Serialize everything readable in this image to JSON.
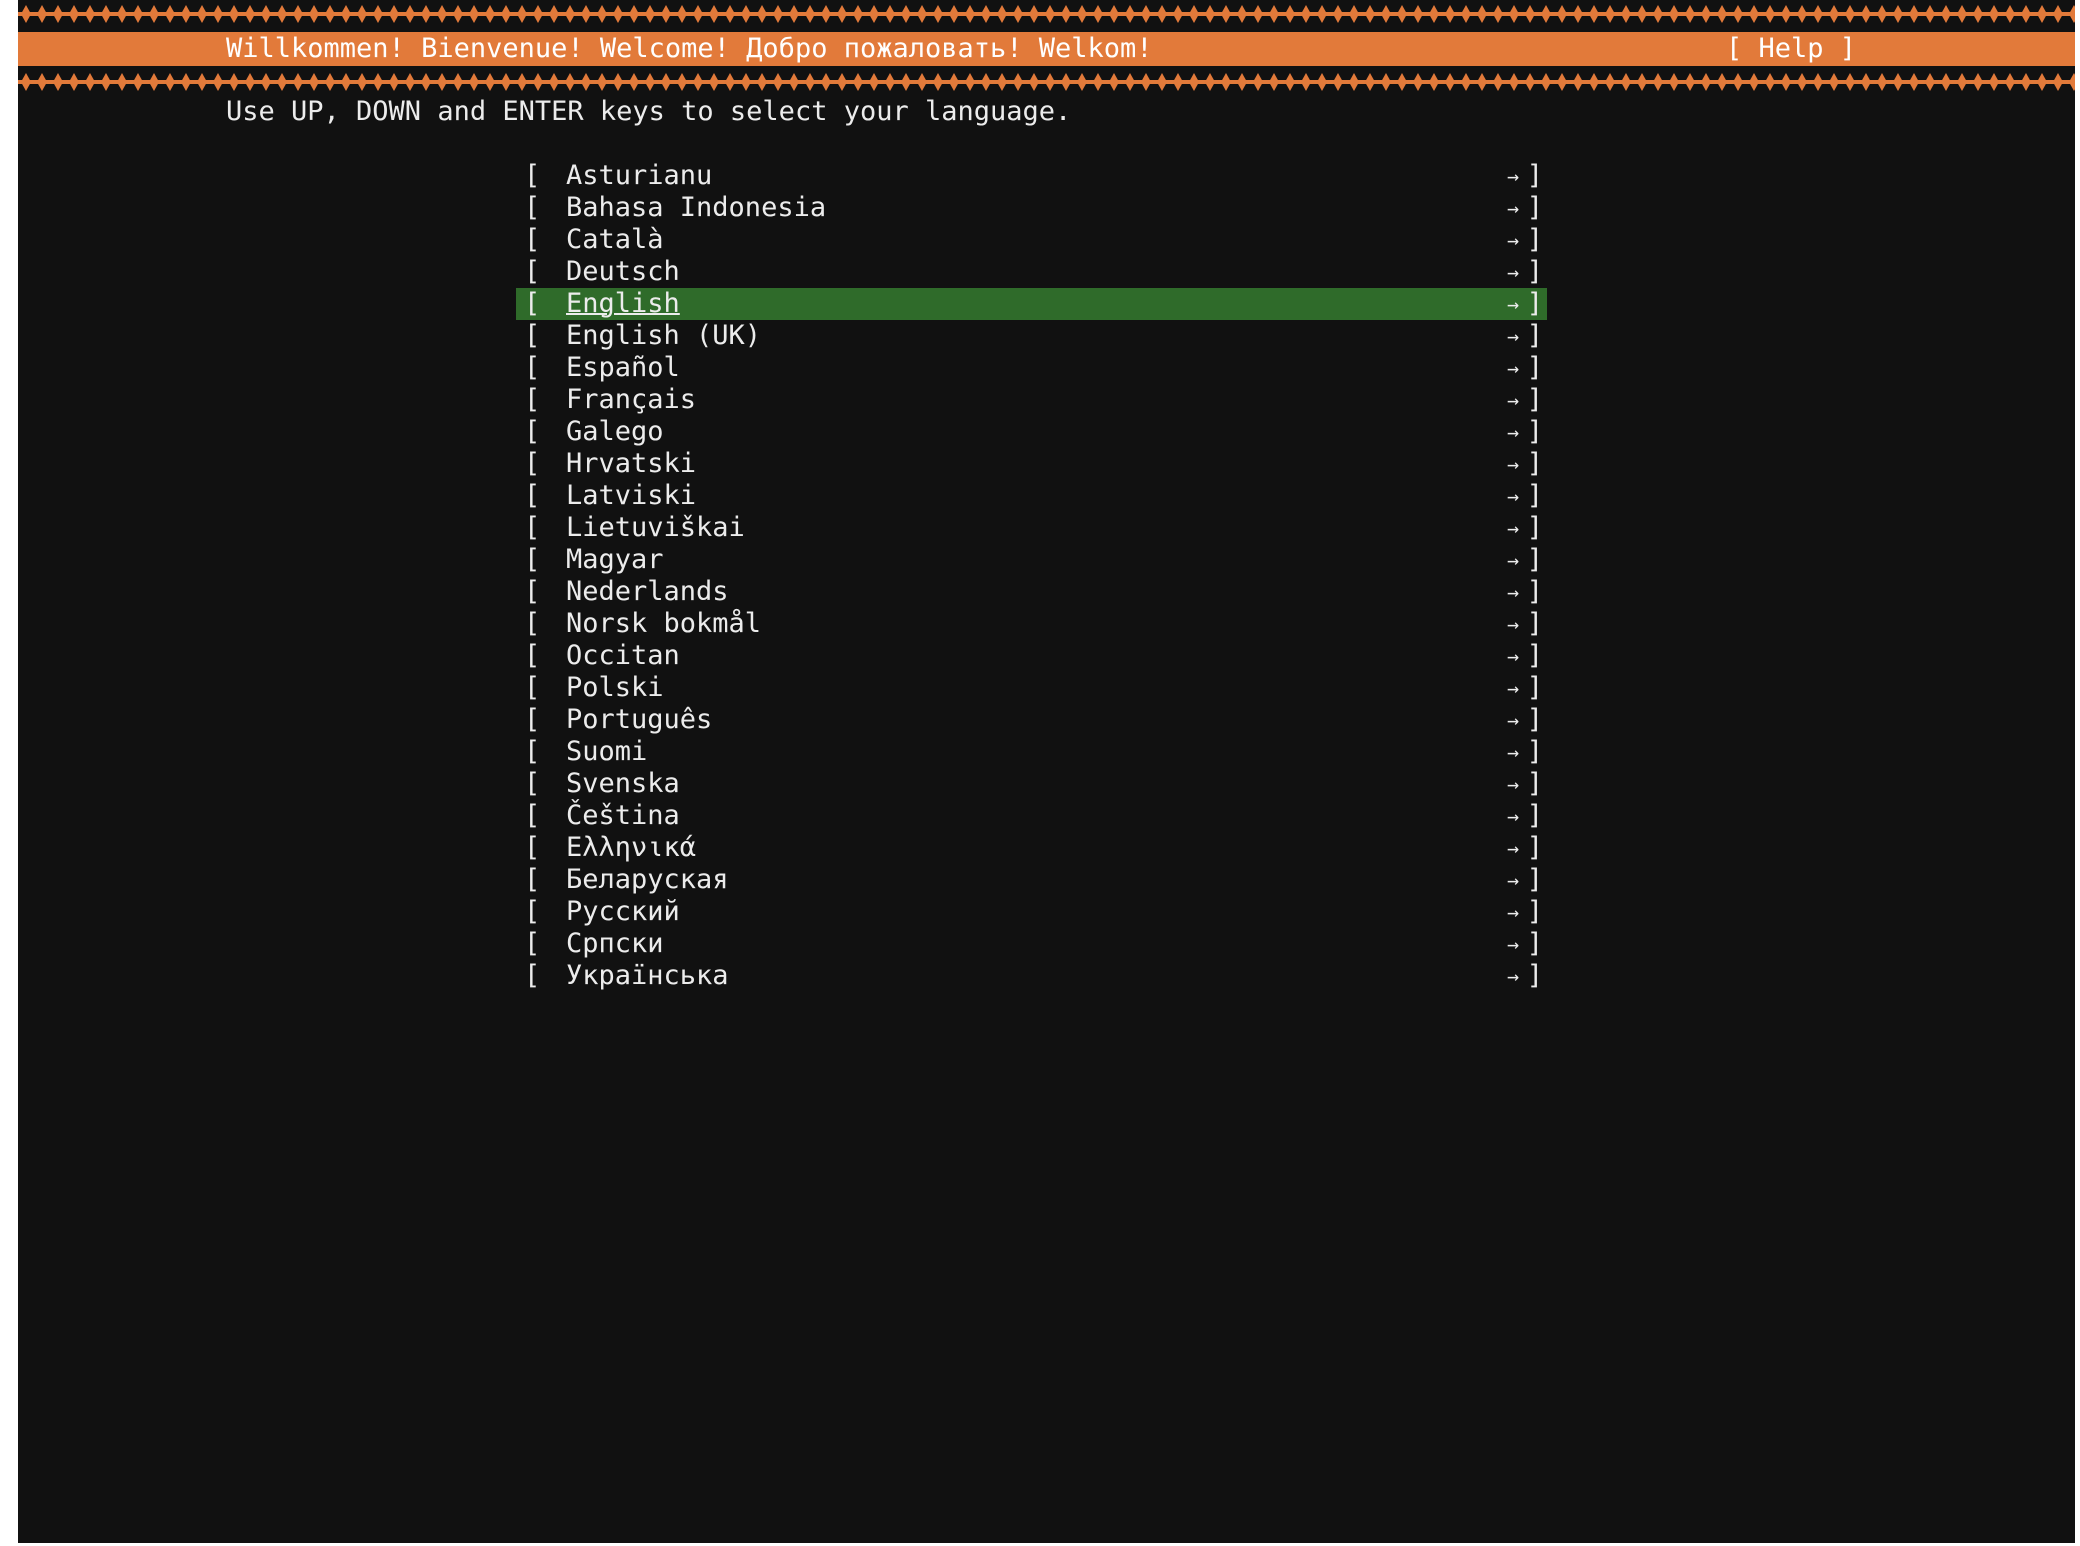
{
  "header": {
    "title": "Willkommen! Bienvenue! Welcome! Добро пожаловать! Welkom!",
    "help_label": "[ Help ]"
  },
  "instruction": "Use UP, DOWN and ENTER keys to select your language.",
  "list": {
    "bracket_open": "[",
    "bracket_close": "]",
    "arrow_glyph": "→",
    "selected_index": 4,
    "items": [
      {
        "label": "Asturianu"
      },
      {
        "label": "Bahasa Indonesia"
      },
      {
        "label": "Català"
      },
      {
        "label": "Deutsch"
      },
      {
        "label": "English"
      },
      {
        "label": "English (UK)"
      },
      {
        "label": "Español"
      },
      {
        "label": "Français"
      },
      {
        "label": "Galego"
      },
      {
        "label": "Hrvatski"
      },
      {
        "label": "Latviski"
      },
      {
        "label": "Lietuviškai"
      },
      {
        "label": "Magyar"
      },
      {
        "label": "Nederlands"
      },
      {
        "label": "Norsk bokmål"
      },
      {
        "label": "Occitan"
      },
      {
        "label": "Polski"
      },
      {
        "label": "Português"
      },
      {
        "label": "Suomi"
      },
      {
        "label": "Svenska"
      },
      {
        "label": "Čeština"
      },
      {
        "label": "Ελληνικά"
      },
      {
        "label": "Беларуская"
      },
      {
        "label": "Русский"
      },
      {
        "label": "Српски"
      },
      {
        "label": "Українська"
      }
    ]
  },
  "colors": {
    "accent": "#e27a3a",
    "selection": "#2f6b2a",
    "background": "#111111",
    "text": "#ececec"
  }
}
